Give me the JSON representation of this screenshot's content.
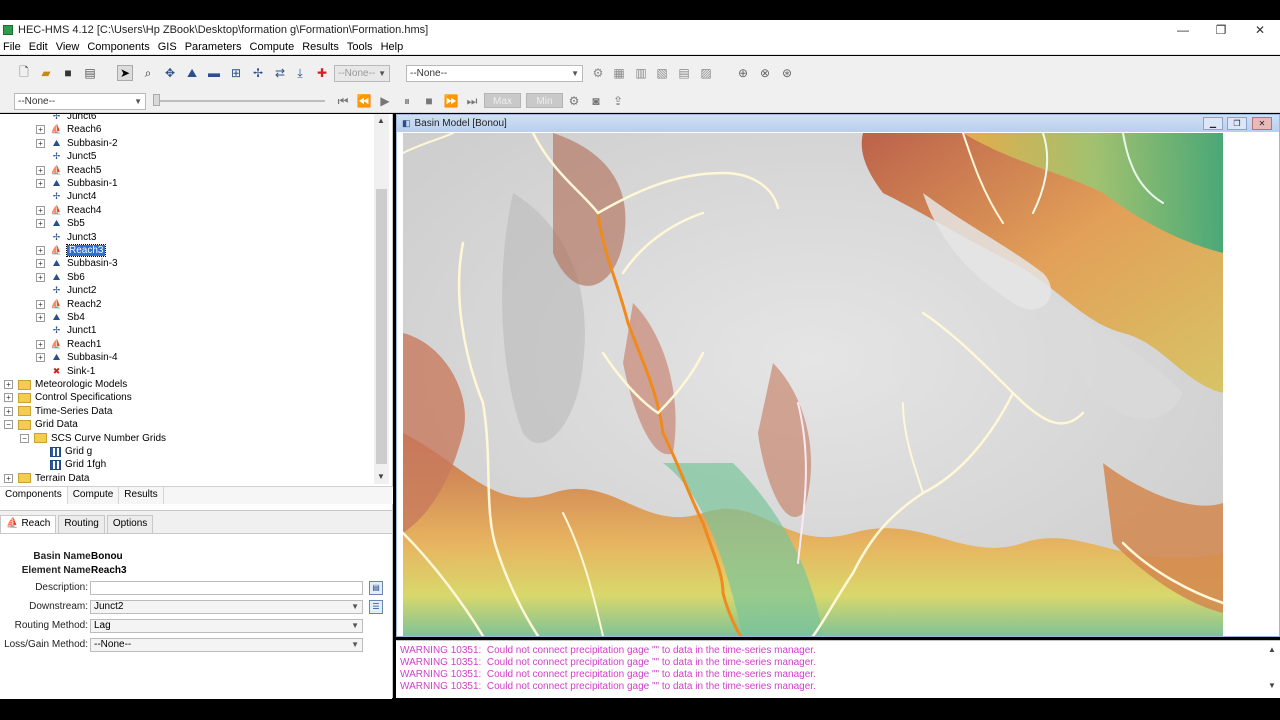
{
  "window": {
    "title": "HEC-HMS 4.12 [C:\\Users\\Hp ZBook\\Desktop\\formation g\\Formation\\Formation.hms]",
    "controls": [
      "—",
      "❐",
      "✕"
    ]
  },
  "menu": [
    "File",
    "Edit",
    "View",
    "Components",
    "GIS",
    "Parameters",
    "Compute",
    "Results",
    "Tools",
    "Help"
  ],
  "toolbar": {
    "combo_small": "--None--",
    "combo_run": "--None--",
    "combo_left": "--None--",
    "max_label": "Max",
    "min_label": "Min"
  },
  "tree": [
    {
      "label": "Junct6",
      "icon": "junction-icon",
      "level": 2,
      "exp": ""
    },
    {
      "label": "Reach6",
      "icon": "reach-icon",
      "level": 2,
      "exp": "+"
    },
    {
      "label": "Subbasin-2",
      "icon": "subbasin-icon",
      "level": 2,
      "exp": "+"
    },
    {
      "label": "Junct5",
      "icon": "junction-icon",
      "level": 2,
      "exp": ""
    },
    {
      "label": "Reach5",
      "icon": "reach-icon",
      "level": 2,
      "exp": "+"
    },
    {
      "label": "Subbasin-1",
      "icon": "subbasin-icon",
      "level": 2,
      "exp": "+"
    },
    {
      "label": "Junct4",
      "icon": "junction-icon",
      "level": 2,
      "exp": ""
    },
    {
      "label": "Reach4",
      "icon": "reach-icon",
      "level": 2,
      "exp": "+"
    },
    {
      "label": "Sb5",
      "icon": "subbasin-icon",
      "level": 2,
      "exp": "+"
    },
    {
      "label": "Junct3",
      "icon": "junction-icon",
      "level": 2,
      "exp": ""
    },
    {
      "label": "Reach3",
      "icon": "reach-icon",
      "level": 2,
      "exp": "+",
      "selected": true
    },
    {
      "label": "Subbasin-3",
      "icon": "subbasin-icon",
      "level": 2,
      "exp": "+"
    },
    {
      "label": "Sb6",
      "icon": "subbasin-icon",
      "level": 2,
      "exp": "+"
    },
    {
      "label": "Junct2",
      "icon": "junction-icon",
      "level": 2,
      "exp": ""
    },
    {
      "label": "Reach2",
      "icon": "reach-icon",
      "level": 2,
      "exp": "+"
    },
    {
      "label": "Sb4",
      "icon": "subbasin-icon",
      "level": 2,
      "exp": "+"
    },
    {
      "label": "Junct1",
      "icon": "junction-icon",
      "level": 2,
      "exp": ""
    },
    {
      "label": "Reach1",
      "icon": "reach-icon",
      "level": 2,
      "exp": "+"
    },
    {
      "label": "Subbasin-4",
      "icon": "subbasin-icon",
      "level": 2,
      "exp": "+"
    },
    {
      "label": "Sink-1",
      "icon": "sink-icon",
      "level": 2,
      "exp": ""
    },
    {
      "label": "Meteorologic Models",
      "icon": "folder-icon",
      "level": 0,
      "exp": "+"
    },
    {
      "label": "Control Specifications",
      "icon": "folder-icon",
      "level": 0,
      "exp": "+"
    },
    {
      "label": "Time-Series Data",
      "icon": "folder-icon",
      "level": 0,
      "exp": "+"
    },
    {
      "label": "Grid Data",
      "icon": "folder-icon",
      "level": 0,
      "exp": "−"
    },
    {
      "label": "SCS Curve Number Grids",
      "icon": "folder-icon",
      "level": 1,
      "exp": "−"
    },
    {
      "label": "Grid g",
      "icon": "grid-icon",
      "level": 2,
      "exp": ""
    },
    {
      "label": "Grid 1fgh",
      "icon": "grid-icon",
      "level": 2,
      "exp": ""
    },
    {
      "label": "Terrain Data",
      "icon": "folder-icon",
      "level": 0,
      "exp": "+"
    }
  ],
  "explorer_tabs": [
    "Components",
    "Compute",
    "Results"
  ],
  "editor": {
    "tabs": [
      "Reach",
      "Routing",
      "Options"
    ],
    "basin_name_label": "Basin Name:",
    "basin_name": "Bonou",
    "element_name_label": "Element Name:",
    "element_name": "Reach3",
    "description_label": "Description:",
    "description": "",
    "downstream_label": "Downstream:",
    "downstream": "Junct2",
    "routing_label": "Routing Method:",
    "routing": "Lag",
    "lossgain_label": "Loss/Gain Method:",
    "lossgain": "--None--"
  },
  "map": {
    "title": "Basin Model [Bonou]"
  },
  "log": [
    "WARNING 10351:  Could not connect precipitation gage \"\" to data in the time-series manager.",
    "WARNING 10351:  Could not connect precipitation gage \"\" to data in the time-series manager.",
    "WARNING 10351:  Could not connect precipitation gage \"\" to data in the time-series manager.",
    "WARNING 10351:  Could not connect precipitation gage \"\" to data in the time-series manager."
  ],
  "colors": {
    "selection": "#2f6fd0",
    "warning_text": "#d040c8",
    "stream_main": "#f08a1c",
    "stream_other": "#fff7d6"
  }
}
